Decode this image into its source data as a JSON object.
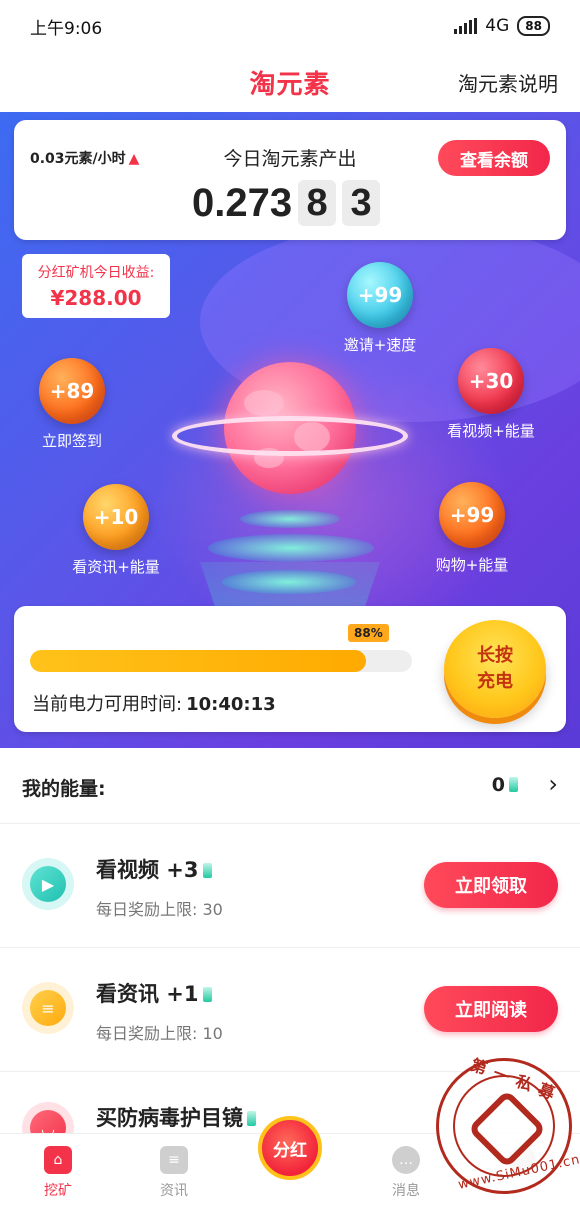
{
  "status_bar": {
    "time": "上午9:06",
    "network": "4G",
    "battery": "88"
  },
  "header": {
    "title": "淘元素",
    "help_link": "淘元素说明"
  },
  "output": {
    "rate": "0.03元素/小时",
    "title": "今日淘元素产出",
    "balance_button": "查看余额",
    "value_main": "0.273",
    "digit_1": "8",
    "digit_2": "3"
  },
  "dividend": {
    "label": "分红矿机今日收益:",
    "value": "¥288.00"
  },
  "bubbles": {
    "invite": {
      "value": "+99",
      "label": "邀请+速度"
    },
    "checkin": {
      "value": "+89",
      "label": "立即签到"
    },
    "video": {
      "value": "+30",
      "label": "看视频+能量"
    },
    "news": {
      "value": "+10",
      "label": "看资讯+能量"
    },
    "shopping": {
      "value": "+99",
      "label": "购物+能量"
    }
  },
  "power": {
    "percent_label": "88%",
    "percent": 88,
    "time_label": "当前电力可用时间:",
    "time_value": "10:40:13",
    "charge_button_line1": "长按",
    "charge_button_line2": "充电"
  },
  "energy": {
    "label": "我的能量:",
    "value": "0"
  },
  "tasks": [
    {
      "title": "看视频 +3",
      "subtitle": "每日奖励上限: 30",
      "button": "立即领取"
    },
    {
      "title": "看资讯 +1",
      "subtitle": "每日奖励上限: 10",
      "button": "立即阅读"
    },
    {
      "title": "买防病毒护目镜",
      "subtitle": "",
      "button": ""
    }
  ],
  "bottom_nav": [
    {
      "label": "挖矿"
    },
    {
      "label": "资讯"
    },
    {
      "label": "分红"
    },
    {
      "label": "消息"
    },
    {
      "label": ""
    }
  ],
  "watermark": {
    "top_text": "第一私募",
    "bottom_text": "www.SiMu001.cn"
  },
  "colors": {
    "brand_red": "#f2334a",
    "hero_blue": "#3d6bf2",
    "hero_purple": "#6a3fe0",
    "progress": "#ffb41a"
  }
}
